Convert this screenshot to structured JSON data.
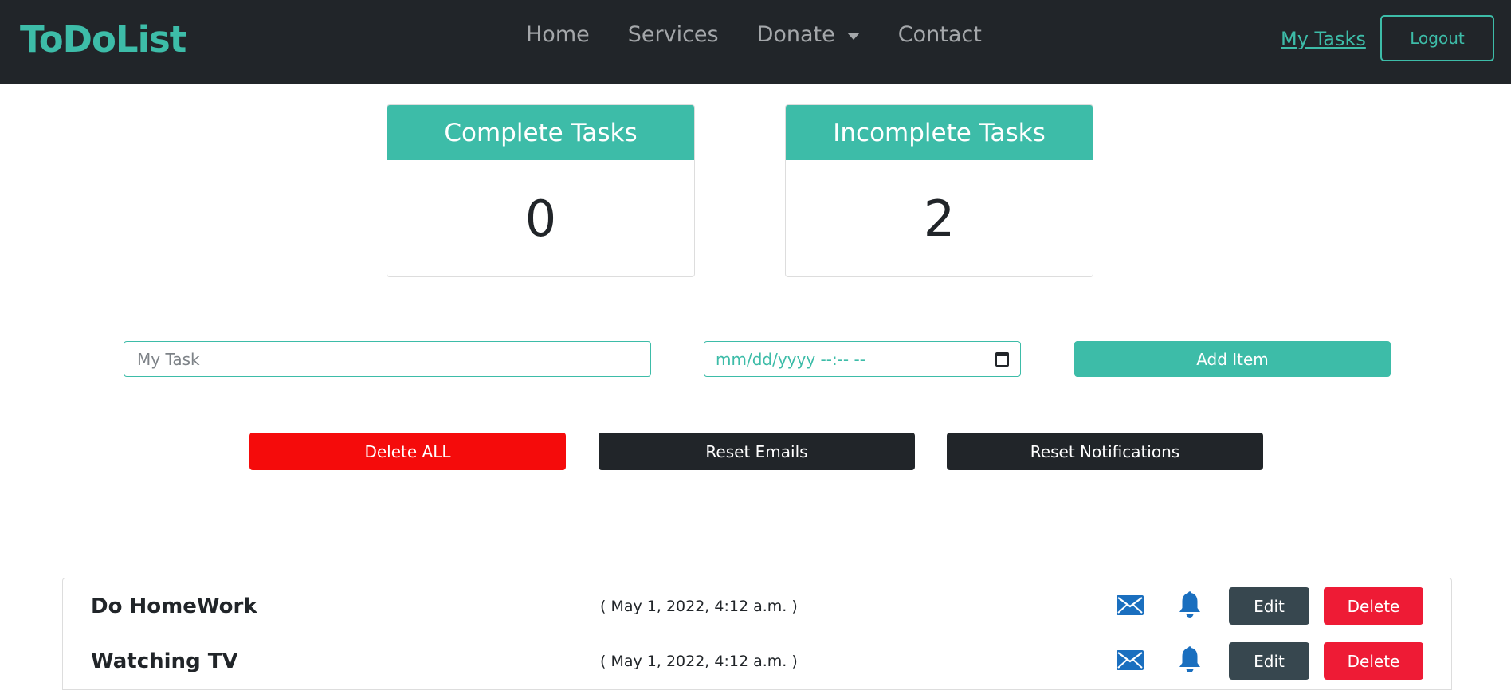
{
  "navbar": {
    "brand": "ToDoList",
    "links": [
      {
        "label": "Home"
      },
      {
        "label": "Services"
      },
      {
        "label": "Donate"
      },
      {
        "label": "Contact"
      }
    ],
    "my_tasks": "My Tasks",
    "logout": "Logout"
  },
  "stats": {
    "complete": {
      "title": "Complete Tasks",
      "count": "0"
    },
    "incomplete": {
      "title": "Incomplete Tasks",
      "count": "2"
    }
  },
  "form": {
    "task_placeholder": "My Task",
    "date_placeholder": "mm/dd/yyyy --:-- --",
    "add_label": "Add Item"
  },
  "actions": {
    "delete_all": "Delete ALL",
    "reset_emails": "Reset Emails",
    "reset_notifications": "Reset Notifications"
  },
  "tasks": [
    {
      "name": "Do HomeWork",
      "date": "( May 1, 2022, 4:12 a.m. )",
      "edit": "Edit",
      "delete": "Delete"
    },
    {
      "name": "Watching TV",
      "date": "( May 1, 2022, 4:12 a.m. )",
      "edit": "Edit",
      "delete": "Delete"
    }
  ],
  "colors": {
    "accent": "#3dbca8",
    "navbar_bg": "#212529",
    "danger": "#f50b0b",
    "delete": "#ee1b35",
    "edit": "#37474f",
    "icon_blue": "#1a6fbf"
  },
  "icons": {
    "mail": "envelope-icon",
    "bell": "bell-icon",
    "calendar": "calendar-icon"
  }
}
